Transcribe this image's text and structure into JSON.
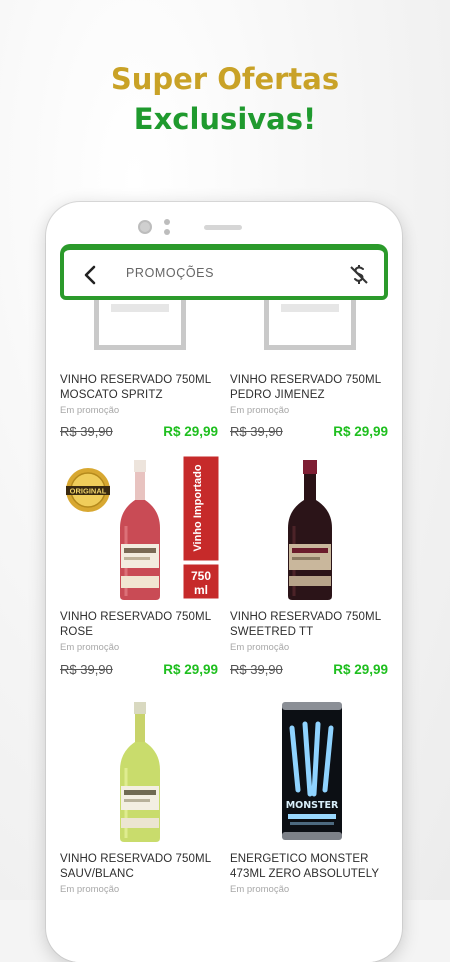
{
  "headline": {
    "line1": "Super Ofertas",
    "line2": "Exclusivas!",
    "line1_color": "#c9a227",
    "line2_color": "#1f9a2e"
  },
  "appbar": {
    "title": "PROMOÇÕES",
    "back_icon": "chevron-left-icon",
    "action_icon": "no-price-tag-icon",
    "accent": "#2b9a2b"
  },
  "products": [
    {
      "name": "VINHO RESERVADO 750ML MOSCATO SPRITZ",
      "status": "Em promoção",
      "old_price": "R$ 39,90",
      "price": "R$ 29,99",
      "image": "image-placeholder"
    },
    {
      "name": "VINHO RESERVADO 750ML PEDRO JIMENEZ",
      "status": "Em promoção",
      "old_price": "R$ 39,90",
      "price": "R$ 29,99",
      "image": "image-placeholder"
    },
    {
      "name": "VINHO RESERVADO 750ML ROSE",
      "status": "Em promoção",
      "old_price": "R$ 39,90",
      "price": "R$ 29,99",
      "image": "rose-wine-bottle",
      "seal_text": "ORIGINAL",
      "banner_text": "Vinho Importado",
      "volume_text": "750 ml"
    },
    {
      "name": "VINHO RESERVADO 750ML SWEETRED TT",
      "status": "Em promoção",
      "old_price": "R$ 39,90",
      "price": "R$ 29,99",
      "image": "red-wine-bottle"
    },
    {
      "name": "VINHO RESERVADO 750ML SAUV/BLANC",
      "status": "Em promoção",
      "image": "white-wine-bottle"
    },
    {
      "name": "ENERGETICO MONSTER 473ML ZERO ABSOLUTELY",
      "status": "Em promoção",
      "image": "monster-energy-can",
      "can_text": "MONSTER"
    }
  ]
}
